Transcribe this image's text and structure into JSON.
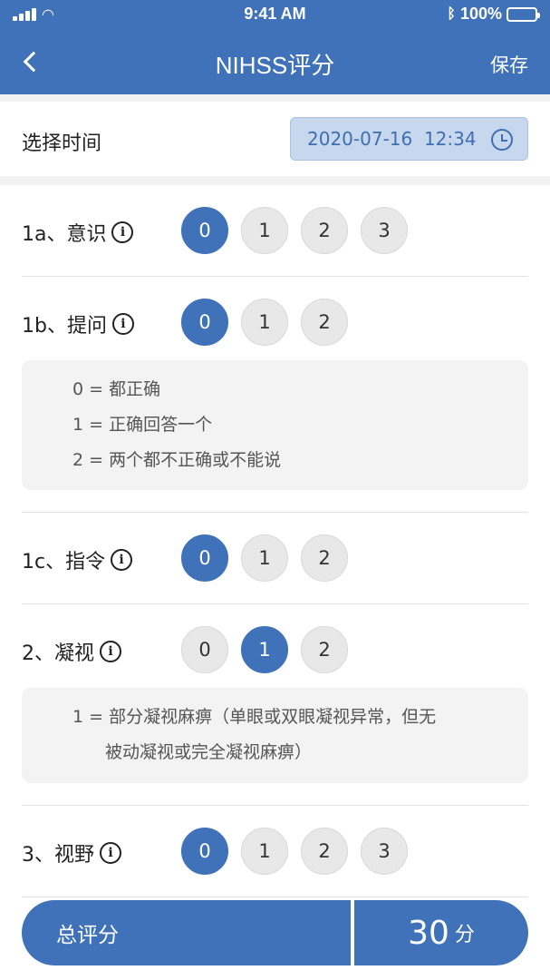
{
  "status_bar": {
    "time": "9:41 AM",
    "battery": "100%"
  },
  "header": {
    "title": "NIHSS评分",
    "save_label": "保存"
  },
  "time_row": {
    "label": "选择时间",
    "value": "2020-07-16  12:34"
  },
  "items": [
    {
      "label": "1a、意识",
      "options": [
        "0",
        "1",
        "2",
        "3"
      ],
      "selected": 0
    },
    {
      "label": "1b、提问",
      "options": [
        "0",
        "1",
        "2"
      ],
      "selected": 0,
      "description": [
        "0 = 都正确",
        "1 = 正确回答一个",
        "2 = 两个都不正确或不能说"
      ]
    },
    {
      "label": "1c、指令",
      "options": [
        "0",
        "1",
        "2"
      ],
      "selected": 0
    },
    {
      "label": "2、凝视",
      "options": [
        "0",
        "1",
        "2"
      ],
      "selected": 1,
      "description": [
        "1 = 部分凝视麻痹（单眼或双眼凝视异常，但无",
        "被动凝视或完全凝视麻痹）"
      ]
    },
    {
      "label": "3、视野",
      "options": [
        "0",
        "1",
        "2",
        "3"
      ],
      "selected": 0
    }
  ],
  "total": {
    "label": "总评分",
    "value": "30",
    "unit": "分"
  },
  "icons": {
    "back": "chevron-left-icon",
    "clock": "clock-icon",
    "info": "info-icon"
  },
  "colors": {
    "primary": "#3f72b8",
    "picker_bg": "#c7d8ee"
  }
}
